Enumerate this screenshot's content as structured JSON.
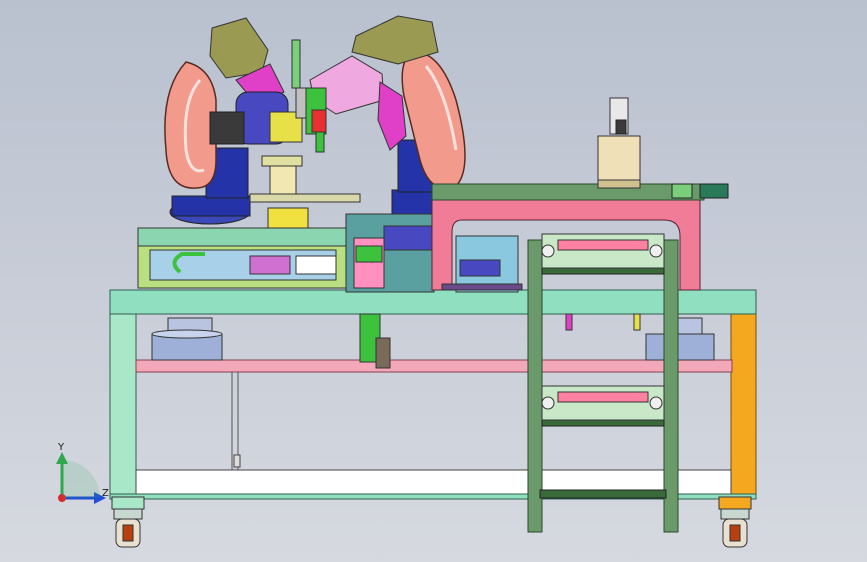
{
  "view": {
    "background_top": "#b9c1cf",
    "background_bottom": "#d6d9e0"
  },
  "triad": {
    "y_label": "Y",
    "z_label": "Z",
    "y_color": "#2fa84f",
    "z_color": "#1f4fd6",
    "x_color": "#d62b2b"
  },
  "colors": {
    "frame": "#a8e8c8",
    "frame_beam": "#8fdfc0",
    "shelf": "#f2a8b8",
    "robot_orange": "#f29a8c",
    "robot_olive": "#9a9a52",
    "robot_blue": "#2434a8",
    "magenta": "#e040c8",
    "green": "#3cc23c",
    "yellow": "#e8e048",
    "orange_leg": "#f4a820",
    "rail": "#5a8a5a",
    "pink_frame": "#f07c98"
  }
}
